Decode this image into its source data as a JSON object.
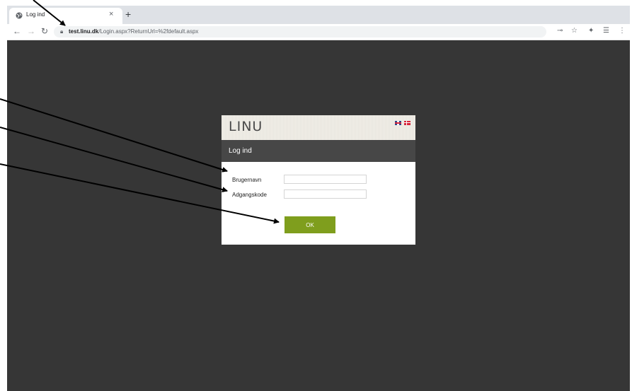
{
  "browser": {
    "tab_title": "Log ind",
    "tab_close": "×",
    "new_tab": "+",
    "url_host": "test.linu.dk",
    "url_path": "/Login.aspx?ReturnUrl=%2fdefault.aspx"
  },
  "login": {
    "logo": "LINU",
    "heading": "Log ind",
    "username_label": "Brugernavn",
    "username_value": "",
    "password_label": "Adgangskode",
    "password_value": "",
    "ok_label": "OK"
  },
  "colors": {
    "page_background": "#363636",
    "header_bar": "#474747",
    "ok_button": "#7f9e1d"
  }
}
